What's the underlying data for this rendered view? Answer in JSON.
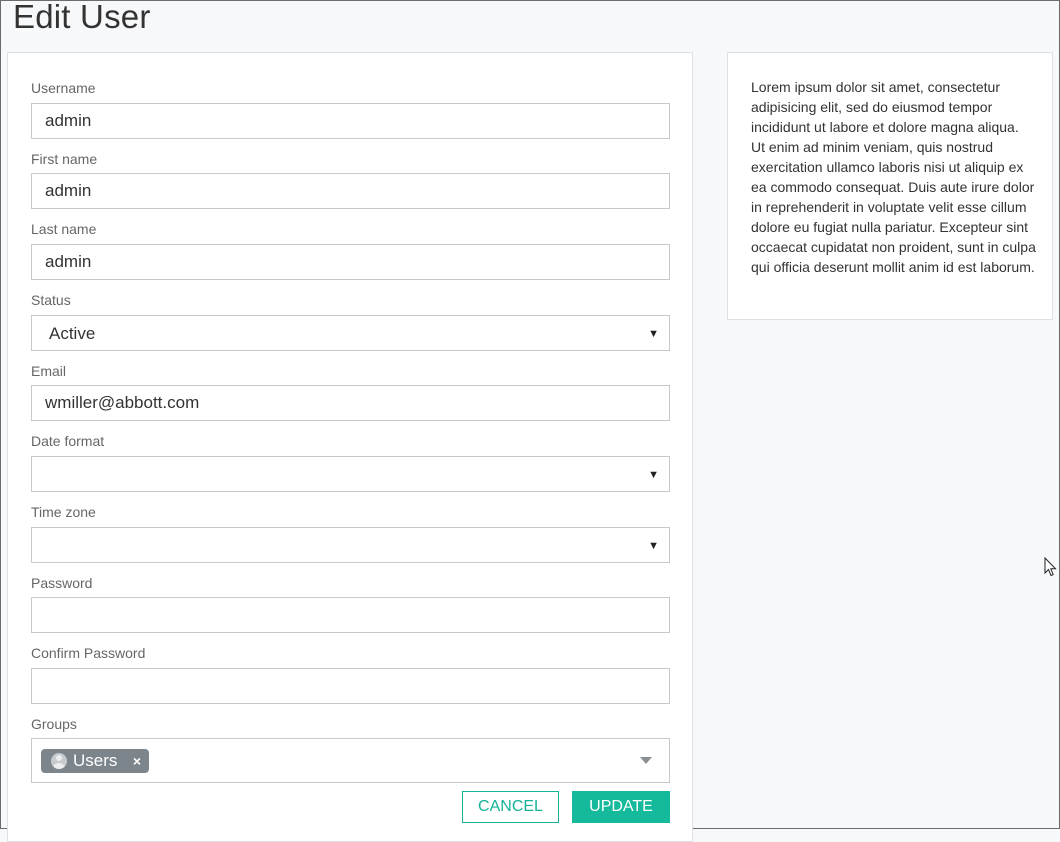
{
  "page": {
    "title": "Edit User"
  },
  "form": {
    "username": {
      "label": "Username",
      "value": "admin"
    },
    "first_name": {
      "label": "First name",
      "value": "admin"
    },
    "last_name": {
      "label": "Last name",
      "value": "admin"
    },
    "status": {
      "label": "Status",
      "value": "Active"
    },
    "email": {
      "label": "Email",
      "value": "wmiller@abbott.com"
    },
    "date_format": {
      "label": "Date format",
      "value": ""
    },
    "time_zone": {
      "label": "Time zone",
      "value": ""
    },
    "password": {
      "label": "Password",
      "value": ""
    },
    "confirm_password": {
      "label": "Confirm Password",
      "value": ""
    },
    "groups": {
      "label": "Groups",
      "selected": [
        {
          "label": "Users",
          "remove_glyph": "×",
          "icon": "user-avatar-icon"
        }
      ]
    }
  },
  "actions": {
    "cancel_label": "CANCEL",
    "update_label": "UPDATE"
  },
  "info": {
    "text": "Lorem ipsum dolor sit amet, consectetur adipisicing elit, sed do eiusmod tempor incididunt ut labore et dolore magna aliqua. Ut enim ad minim veniam, quis nostrud exercitation ullamco laboris nisi ut aliquip ex ea commodo consequat. Duis aute irure dolor in reprehenderit in voluptate velit esse cillum dolore eu fugiat nulla pariatur. Excepteur sint occaecat cupidatat non proident, sunt in culpa qui officia deserunt mollit anim id est laborum."
  },
  "icons": {
    "select_caret": "▼",
    "groups_caret": "chevron-down-icon",
    "mouse_cursor": "mouse-pointer-icon"
  },
  "colors": {
    "accent": "#15b99b",
    "chip": "#7d858c",
    "background": "#f7f8fa"
  }
}
